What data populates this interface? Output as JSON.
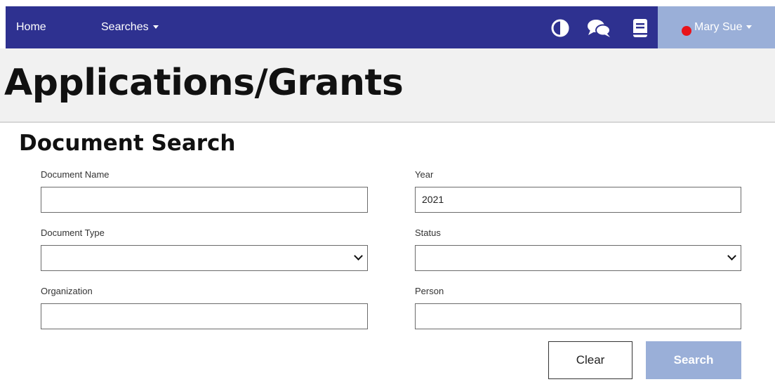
{
  "nav": {
    "home_label": "Home",
    "searches_label": "Searches",
    "icons": [
      "contrast-icon",
      "chat-icon",
      "book-icon"
    ],
    "user_name": "Mary Sue",
    "user_status_color": "#e8131a",
    "bar_color": "#2e3190",
    "user_menu_color": "#9aafd8"
  },
  "page": {
    "title": "Applications/Grants"
  },
  "search_form": {
    "section_title": "Document Search",
    "document_name": {
      "label": "Document Name",
      "value": ""
    },
    "year": {
      "label": "Year",
      "value": "2021"
    },
    "document_type": {
      "label": "Document Type",
      "selected": ""
    },
    "status": {
      "label": "Status",
      "selected": ""
    },
    "organization": {
      "label": "Organization",
      "value": ""
    },
    "person": {
      "label": "Person",
      "value": ""
    },
    "clear_label": "Clear",
    "search_label": "Search"
  }
}
